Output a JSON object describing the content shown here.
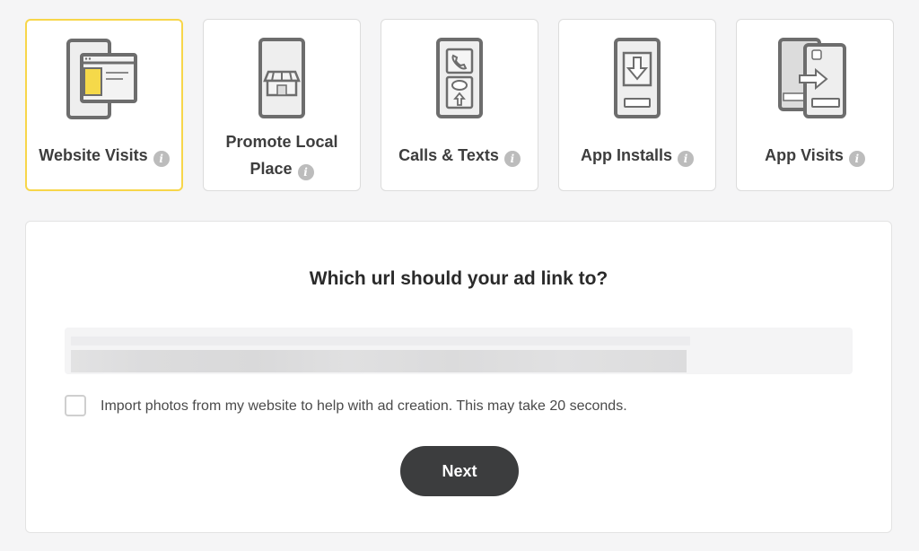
{
  "objectives": [
    {
      "label": "Website Visits",
      "selected": true,
      "icon": "website-visits-icon"
    },
    {
      "label": "Promote Local Place",
      "selected": false,
      "icon": "local-place-icon"
    },
    {
      "label": "Calls & Texts",
      "selected": false,
      "icon": "calls-texts-icon"
    },
    {
      "label": "App Installs",
      "selected": false,
      "icon": "app-installs-icon"
    },
    {
      "label": "App Visits",
      "selected": false,
      "icon": "app-visits-icon"
    }
  ],
  "info_glyph": "i",
  "url_section": {
    "question": "Which url should your ad link to?",
    "url_value": "",
    "import_photos_label": "Import photos from my website to help with ad creation. This may take 20 seconds.",
    "import_photos_checked": false,
    "next_label": "Next"
  },
  "colors": {
    "selected_border": "#f7d64a",
    "accent_yellow": "#f5d94a",
    "button_bg": "#3c3d3e"
  }
}
